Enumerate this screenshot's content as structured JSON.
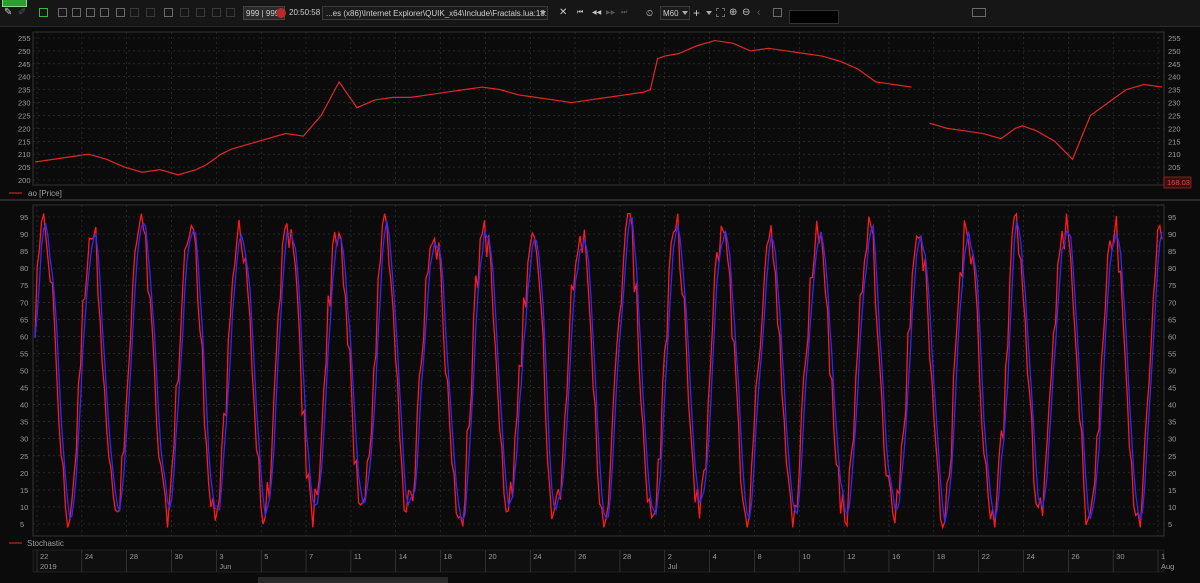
{
  "toolbar": {
    "counter": "999 | 999",
    "time": "20:50:58",
    "script_path": "...es (x86)\\Internet Explorer\\QUIK_x64\\Include\\Fractals.lua:18...",
    "timeframe": "M60",
    "close_glyph": "✕",
    "nav_first": "⏮",
    "nav_prev": "◀◀",
    "nav_next": "▶▶",
    "nav_last": "⏭",
    "plus_glyph": "+",
    "zoom_in": "⊕",
    "zoom_out": "⊖",
    "icons": [
      "pencil-icon",
      "tool-icon",
      "save-icon",
      "layout-icon",
      "table-icon",
      "window-icon",
      "checkbox-icon",
      "lock-icon",
      "chat-icon",
      "settings-icon",
      "hand-icon",
      "order-icon",
      "stop-icon",
      "crosshair-icon",
      "fit-icon",
      "zoom-in-icon",
      "zoom-out-icon",
      "print-icon",
      "list-icon"
    ]
  },
  "price_panel": {
    "legend": "ao [Price]",
    "last_value": "168.03",
    "y_ticks": [
      "255",
      "250",
      "245",
      "240",
      "235",
      "230",
      "225",
      "220",
      "215",
      "210",
      "205",
      "200"
    ],
    "y_values": [
      255,
      250,
      245,
      240,
      235,
      230,
      225,
      220,
      215,
      210,
      205,
      200
    ]
  },
  "osc_panel": {
    "legend": "Stochastic",
    "y_ticks": [
      "95",
      "90",
      "85",
      "80",
      "75",
      "70",
      "65",
      "60",
      "55",
      "50",
      "45",
      "40",
      "35",
      "30",
      "25",
      "20",
      "15",
      "10",
      "5"
    ],
    "y_values": [
      95,
      90,
      85,
      80,
      75,
      70,
      65,
      60,
      55,
      50,
      45,
      40,
      35,
      30,
      25,
      20,
      15,
      10,
      5
    ]
  },
  "x_axis": {
    "day_labels": [
      "22",
      "24",
      "28",
      "30",
      "3",
      "5",
      "7",
      "11",
      "14",
      "18",
      "20",
      "24",
      "26",
      "28",
      "2",
      "4",
      "8",
      "10",
      "12",
      "16",
      "18",
      "22",
      "24",
      "26",
      "30",
      "1"
    ],
    "month_labels": [
      "2019",
      "Jun",
      "Jul",
      "Aug"
    ]
  },
  "colors": {
    "background": "#0b0b0b",
    "grid": "#3a3a3a",
    "price": "#e02828",
    "stoch_k": "#ff1a1a",
    "stoch_d": "#2a2aff",
    "axis_text": "#9a9a9a",
    "last_value_box": "#c62828"
  },
  "chart_data": {
    "type": "line",
    "series": [
      {
        "name": "ao [Price]",
        "x": [
          0,
          5,
          10,
          15,
          20,
          25,
          30,
          35,
          40,
          45,
          48,
          50,
          52,
          55,
          60,
          65,
          70,
          75,
          80,
          85,
          90,
          95,
          100,
          105,
          110,
          115,
          120,
          125,
          130,
          135,
          140,
          145,
          150,
          155,
          160,
          165,
          170,
          172,
          174,
          176,
          180,
          185,
          190,
          195,
          200,
          205,
          210,
          215,
          220,
          225,
          230,
          235,
          240,
          245,
          250,
          255,
          260,
          265,
          270,
          272,
          274,
          276,
          280,
          285,
          290,
          295,
          300,
          305,
          310,
          315
        ],
        "values": [
          207,
          208,
          209,
          210,
          208,
          205,
          203,
          204,
          202,
          204,
          206,
          208,
          210,
          212,
          214,
          216,
          218,
          217,
          225,
          238,
          228,
          231,
          232,
          232,
          233,
          234,
          235,
          236,
          235,
          233,
          232,
          231,
          230,
          231,
          232,
          233,
          234,
          235,
          247,
          248,
          249,
          252,
          254,
          253,
          250,
          251,
          250,
          249,
          248,
          246,
          243,
          238,
          237,
          236,
          222,
          220,
          219,
          218,
          216,
          218,
          220,
          221,
          219,
          215,
          208,
          225,
          230,
          235,
          237,
          236
        ]
      }
    ]
  }
}
